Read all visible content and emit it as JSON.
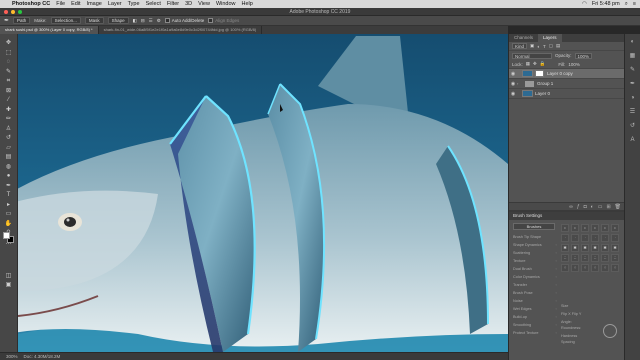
{
  "menubar": {
    "app_name": "Photoshop CC",
    "items": [
      "File",
      "Edit",
      "Image",
      "Layer",
      "Type",
      "Select",
      "Filter",
      "3D",
      "View",
      "Window",
      "Help"
    ],
    "clock": "Fri 5:48 pm"
  },
  "window": {
    "title": "Adobe Photoshop CC 2019"
  },
  "options_bar": {
    "path_label": "Path",
    "make_label": "Make:",
    "selection_label": "Selection...",
    "mask_label": "Mask",
    "shape_label": "Shape",
    "auto_add_delete": "Auto Add/Delete",
    "align_edges": "Align Edges"
  },
  "doc_tabs": [
    {
      "label": "shark sushi.psd @ 300% (Layer 0 copy, RGB/8) *",
      "active": true
    },
    {
      "label": "shark-fin-01_wide-06a8f5f1e2e1f0a1a9a6e8d9e0c3d2f00744fdd.jpg @ 100% (RGB/8)",
      "active": false
    }
  ],
  "status": {
    "zoom": "300%",
    "doc": "Doc: 4.30M/18.2M"
  },
  "panels": {
    "tabs": [
      "Channels",
      "Layers"
    ],
    "active_tab": "Layers",
    "filter_kind": "Kind",
    "blend_mode": "Normal",
    "opacity_label": "Opacity:",
    "opacity_value": "100%",
    "lock_label": "Lock:",
    "fill_label": "Fill:",
    "fill_value": "100%",
    "layers": [
      {
        "name": "Layer 0 copy",
        "selected": true,
        "type": "pixel-mask"
      },
      {
        "name": "Group 1",
        "selected": false,
        "type": "group"
      },
      {
        "name": "Layer 0",
        "selected": false,
        "type": "pixel"
      }
    ]
  },
  "brush_settings": {
    "title": "Brush Settings",
    "brushes_button": "Brushes",
    "options": [
      "Brush Tip Shape",
      "Shape Dynamics",
      "Scattering",
      "Texture",
      "Dual Brush",
      "Color Dynamics",
      "Transfer",
      "Brush Pose",
      "Noise",
      "Wet Edges",
      "Build-up",
      "Smoothing",
      "Protect Texture"
    ],
    "size_label": "Size",
    "flip_x": "Flip X",
    "flip_y": "Flip Y",
    "angle_label": "Angle:",
    "roundness_label": "Roundness:",
    "hardness_label": "Hardness",
    "spacing_label": "Spacing"
  },
  "colors": {
    "water": "#1d5f86",
    "shark_body": "#7fa7b8",
    "band_glow": "#6fe3ff"
  }
}
